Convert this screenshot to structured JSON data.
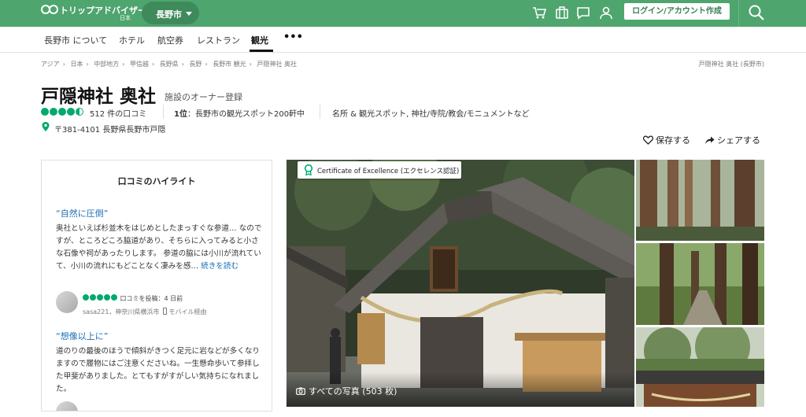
{
  "header": {
    "brand": "トリップアドバイザー",
    "brand_sub": "日本",
    "geo": "長野市",
    "login_label": "ログイン/アカウント作成",
    "accent": "#4ea56e"
  },
  "nav": {
    "items": [
      {
        "label": "長野市 について"
      },
      {
        "label": "ホテル"
      },
      {
        "label": "航空券"
      },
      {
        "label": "レストラン"
      },
      {
        "label": "観光"
      },
      {
        "label": "•••"
      }
    ]
  },
  "breadcrumb": {
    "items": [
      "アジア",
      "日本",
      "中部地方",
      "甲信越",
      "長野県",
      "長野",
      "長野市 観光",
      "戸隠神社 奥社"
    ],
    "right": "戸隠神社 奥社 (長野市)"
  },
  "attraction": {
    "title": "戸隠神社 奥社",
    "owner_link": "施設のオーナー登録",
    "rating": 4.5,
    "review_count": "512 件の口コミ",
    "rank_bold": "1位",
    "rank_text": "：長野市の観光スポット200軒中",
    "categories": "名所 & 観光スポット, 神社/寺院/教会/モニュメントなど",
    "address": "〒381-4101 長野県長野市戸隠",
    "save_label": "保存する",
    "share_label": "シェアする"
  },
  "highlights": {
    "heading": "口コミのハイライト",
    "reviews": [
      {
        "title": "“自然に圧倒”",
        "body": "奥社といえば杉並木をはじめとしたまっすぐな参道… なのですが、ところどころ脇道があり、そちらに入ってみると小さな石像や祠があったりします。 参道の脇には小川が流れていて、小川の流れにもどことなく凄みを感…",
        "more": "続きを読む",
        "rating": 5,
        "posted": "口コミを投稿：4 日前",
        "user": "sasa221，神奈川県横浜市",
        "device": "モバイル経由"
      },
      {
        "title": "“想像以上に”",
        "body": "道のりの最後のほうで傾斜がきつく足元に岩などが多くなりますので履物にはご注意くださいね。一生懸命歩いて参拝した甲斐がありました。とてもすがすがしい気持ちになれました。"
      }
    ]
  },
  "photos": {
    "certificate": "Certificate of Excellence (エクセレンス認証)",
    "all_photos": "すべての写真 (503 枚)"
  }
}
